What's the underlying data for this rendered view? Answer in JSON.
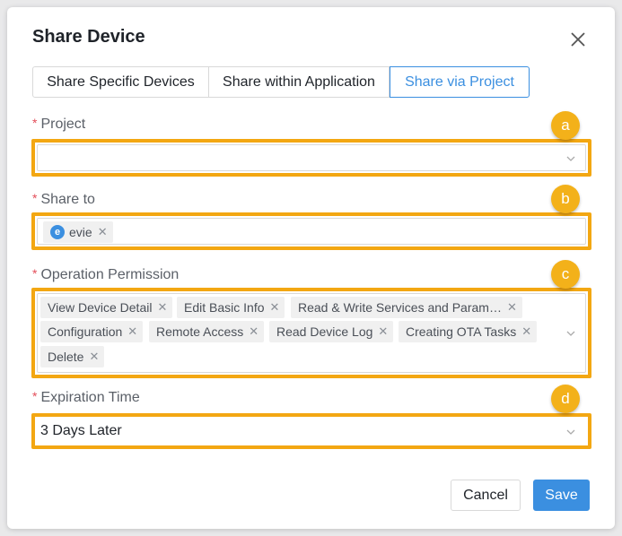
{
  "dialog": {
    "title": "Share Device",
    "close_icon": "close-icon"
  },
  "tabs": [
    {
      "label": "Share Specific Devices",
      "active": false
    },
    {
      "label": "Share within Application",
      "active": false
    },
    {
      "label": "Share via Project",
      "active": true
    }
  ],
  "form": {
    "required_mark": "*",
    "project": {
      "label": "Project",
      "value": "",
      "badge": "a"
    },
    "share_to": {
      "label": "Share to",
      "badge": "b",
      "tags": [
        {
          "avatar": "e",
          "text": "evie"
        }
      ]
    },
    "operation_permission": {
      "label": "Operation Permission",
      "badge": "c",
      "tags": [
        "View Device Detail",
        "Edit Basic Info",
        "Read & Write Services and Param…",
        "Configuration",
        "Remote Access",
        "Read Device Log",
        "Creating OTA Tasks",
        "Delete"
      ]
    },
    "expiration_time": {
      "label": "Expiration Time",
      "value": "3 Days Later",
      "badge": "d"
    }
  },
  "footer": {
    "cancel_label": "Cancel",
    "save_label": "Save"
  },
  "colors": {
    "accent": "#3b8fe0",
    "highlight": "#f3a712",
    "badge": "#f3b11a",
    "required": "#e34d59"
  }
}
